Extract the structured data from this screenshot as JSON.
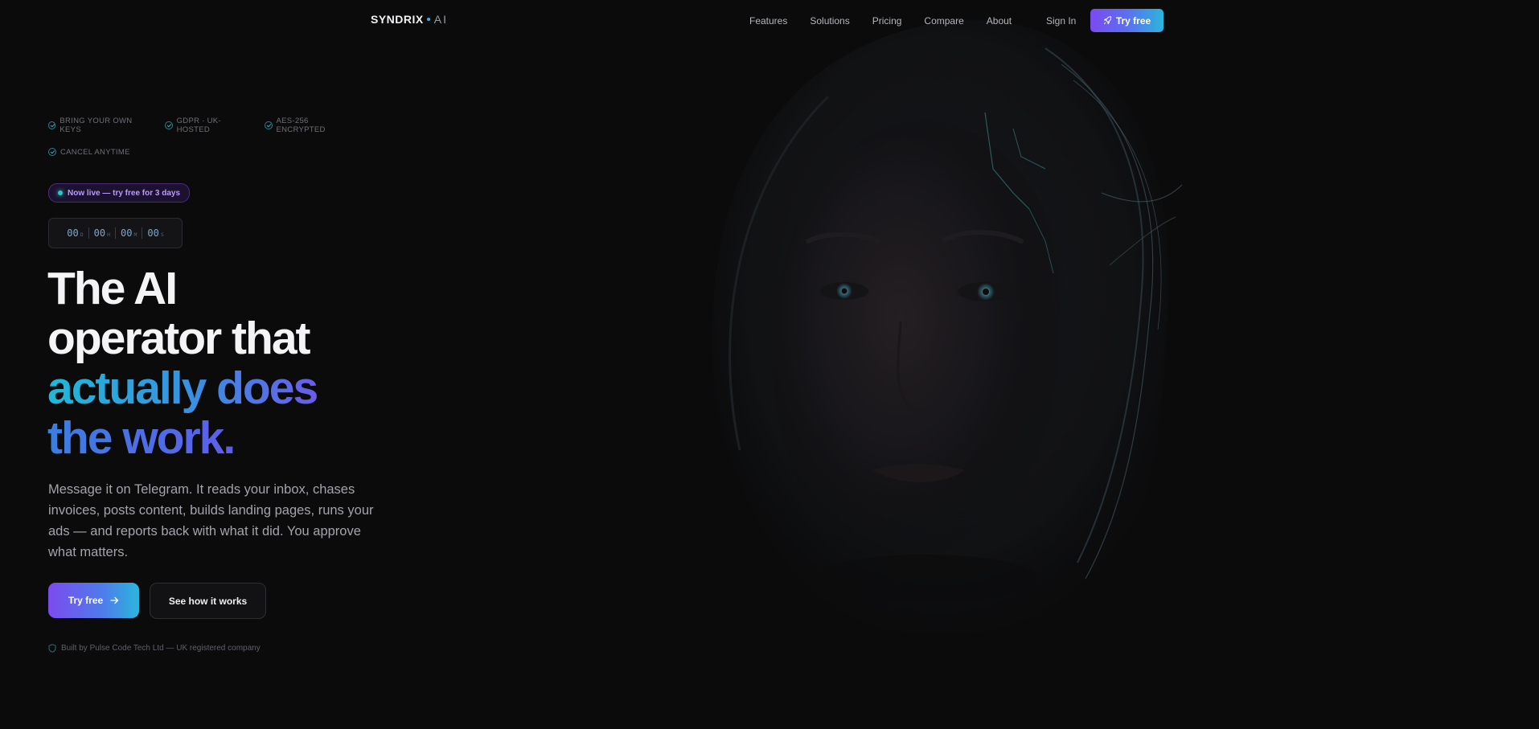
{
  "brand": {
    "name": "SYNDRIX",
    "suffix": "AI"
  },
  "nav": {
    "links": [
      "Features",
      "Solutions",
      "Pricing",
      "Compare",
      "About"
    ],
    "sign_in": "Sign In",
    "cta": "Try free"
  },
  "trust_badges": [
    "BRING YOUR OWN KEYS",
    "GDPR · UK-HOSTED",
    "AES-256 ENCRYPTED",
    "CANCEL ANYTIME"
  ],
  "live_pill": "Now live — try free for 3 days",
  "countdown": [
    {
      "value": "00",
      "unit": "D"
    },
    {
      "value": "00",
      "unit": "H"
    },
    {
      "value": "00",
      "unit": "M"
    },
    {
      "value": "00",
      "unit": "S"
    }
  ],
  "headline": {
    "line1": "The AI",
    "line2": "operator that",
    "line3": "actually does",
    "line4": "the work."
  },
  "description": "Message it on Telegram. It reads your inbox, chases invoices, posts content, builds landing pages, runs your ads — and reports back with what it did. You approve what matters.",
  "ctas": {
    "primary": "Try free",
    "secondary": "See how it works"
  },
  "built_by": "Built by Pulse Code Tech Ltd — UK registered company",
  "colors": {
    "background": "#0b0b0c",
    "accent_purple": "#7b4bef",
    "accent_cyan": "#2bb6dc"
  },
  "icons": {
    "nav_cta": "rocket-icon",
    "trust": "check-circle-icon",
    "primary_cta": "arrow-right-icon",
    "built_by": "shield-icon"
  }
}
